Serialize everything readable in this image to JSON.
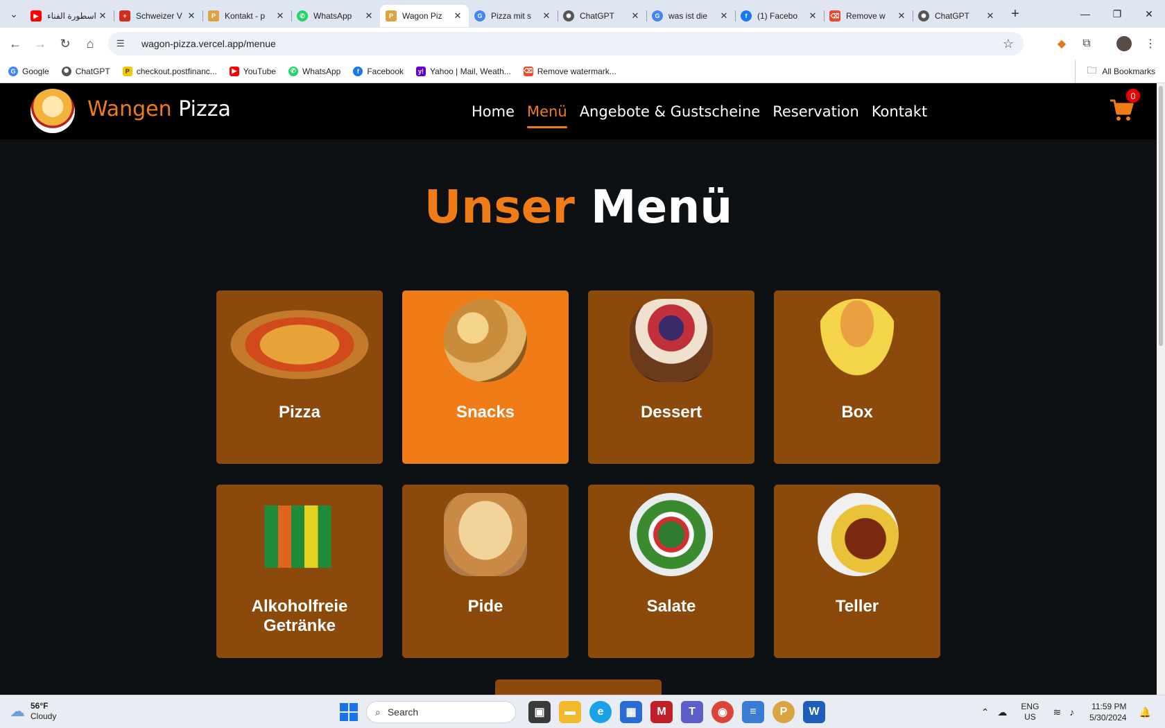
{
  "browser": {
    "tabs": [
      {
        "title": "اسطورة الفناء",
        "favicon": "youtube-icon",
        "color": "#ff0000",
        "active": false
      },
      {
        "title": "Schweizer V",
        "favicon": "swiss-shield-icon",
        "color": "#d52b1e",
        "active": false
      },
      {
        "title": "Kontakt - p",
        "favicon": "pizza-logo-icon",
        "color": "#d9a441",
        "active": false
      },
      {
        "title": "WhatsApp",
        "favicon": "whatsapp-icon",
        "color": "#25d366",
        "active": false
      },
      {
        "title": "Wagon Piz",
        "favicon": "pizza-logo-icon",
        "color": "#d9a441",
        "active": true
      },
      {
        "title": "Pizza mit s",
        "favicon": "google-icon",
        "color": "#4285f4",
        "active": false
      },
      {
        "title": "ChatGPT",
        "favicon": "chatgpt-icon",
        "color": "#555555",
        "active": false
      },
      {
        "title": "was ist die",
        "favicon": "google-icon",
        "color": "#4285f4",
        "active": false
      },
      {
        "title": "(1) Facebo",
        "favicon": "facebook-icon",
        "color": "#1877f2",
        "active": false
      },
      {
        "title": "Remove w",
        "favicon": "watermark-remover-icon",
        "color": "#e8492c",
        "active": false
      },
      {
        "title": "ChatGPT",
        "favicon": "chatgpt-icon",
        "color": "#555555",
        "active": false
      }
    ],
    "url": "wagon-pizza.vercel.app/menue",
    "bookmarks": [
      {
        "label": "Google",
        "icon": "google-icon",
        "color": "#4285f4"
      },
      {
        "label": "ChatGPT",
        "icon": "chatgpt-icon",
        "color": "#555555"
      },
      {
        "label": "checkout.postfinanc...",
        "icon": "postfinance-icon",
        "color": "#f7c600"
      },
      {
        "label": "YouTube",
        "icon": "youtube-icon",
        "color": "#ff0000"
      },
      {
        "label": "WhatsApp",
        "icon": "whatsapp-icon",
        "color": "#25d366"
      },
      {
        "label": "Facebook",
        "icon": "facebook-icon",
        "color": "#1877f2"
      },
      {
        "label": "Yahoo | Mail, Weath...",
        "icon": "yahoo-icon",
        "color": "#6001d2"
      },
      {
        "label": "Remove watermark...",
        "icon": "watermark-remover-icon",
        "color": "#e8492c"
      }
    ],
    "all_bookmarks": "All Bookmarks"
  },
  "site": {
    "brand_first": "Wangen",
    "brand_second": "Pizza",
    "nav": [
      "Home",
      "Menü",
      "Angebote & Gustscheine",
      "Reservation",
      "Kontakt"
    ],
    "active_nav": "Menü",
    "cart_count": "0",
    "accent": "#f07c17"
  },
  "page": {
    "heading_first": "Unser",
    "heading_second": "Menü",
    "categories": [
      {
        "label": "Pizza",
        "highlighted": false
      },
      {
        "label": "Snacks",
        "highlighted": true
      },
      {
        "label": "Dessert",
        "highlighted": false
      },
      {
        "label": "Box",
        "highlighted": false
      },
      {
        "label": "Alkoholfreie Getränke",
        "highlighted": false
      },
      {
        "label": "Pide",
        "highlighted": false
      },
      {
        "label": "Salate",
        "highlighted": false
      },
      {
        "label": "Teller",
        "highlighted": false
      }
    ]
  },
  "taskbar": {
    "weather_temp": "56°F",
    "weather_desc": "Cloudy",
    "search_placeholder": "Search",
    "lang_top": "ENG",
    "lang_bottom": "US",
    "time": "11:59 PM",
    "date": "5/30/2024"
  }
}
